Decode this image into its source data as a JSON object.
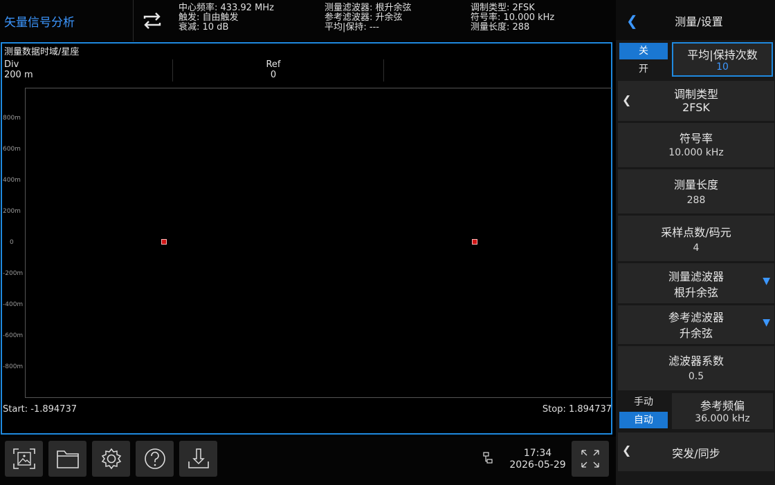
{
  "header": {
    "app_title": "矢量信号分析",
    "col1": [
      "中心频率: 433.92 MHz",
      "触发: 自由触发",
      "衰减: 10 dB"
    ],
    "col2": [
      "测量滤波器: 根升余弦",
      "参考滤波器: 升余弦",
      "平均|保持: ---"
    ],
    "col3": [
      "调制类型: 2FSK",
      "符号率: 10.000 kHz",
      "测量长度: 288"
    ]
  },
  "plot": {
    "title": "测量数据时域/星座",
    "div_label": "Div",
    "div_value": "200 m",
    "ref_label": "Ref",
    "ref_value": "0",
    "y_ticks": [
      "800m",
      "600m",
      "400m",
      "200m",
      "0",
      "-200m",
      "-400m",
      "-600m",
      "-800m"
    ],
    "start": "Start: -1.894737",
    "stop": "Stop: 1.894737",
    "marker_color": "#d01717"
  },
  "toolbar": {
    "icons": [
      "screenshot-icon",
      "folder-icon",
      "settings-gear-icon",
      "help-icon",
      "save-download-icon"
    ],
    "network_icon": "network-icon",
    "time": "17:34",
    "date": "2026-05-29",
    "fullscreen_icon": "fullscreen-icon"
  },
  "panel": {
    "title": "测量/设置",
    "avg_toggle": {
      "off": "关",
      "on": "开",
      "label": "平均|保持次数",
      "value": "10"
    },
    "mod_type": {
      "label": "调制类型",
      "value": "2FSK"
    },
    "symbol_rate": {
      "label": "符号率",
      "value": "10.000 kHz"
    },
    "meas_length": {
      "label": "测量长度",
      "value": "288"
    },
    "samples_per_symbol": {
      "label": "采样点数/码元",
      "value": "4"
    },
    "meas_filter": {
      "label": "测量滤波器",
      "value": "根升余弦"
    },
    "ref_filter": {
      "label": "参考滤波器",
      "value": "升余弦"
    },
    "filter_coef": {
      "label": "滤波器系数",
      "value": "0.5"
    },
    "ref_freq": {
      "manual": "手动",
      "auto": "自动",
      "label": "参考频偏",
      "value": "36.000 kHz"
    },
    "burst_sync": {
      "label": "突发/同步"
    }
  },
  "colors": {
    "accent": "#1f8ae0",
    "title_blue": "#3c97ff",
    "marker": "#d01717"
  }
}
